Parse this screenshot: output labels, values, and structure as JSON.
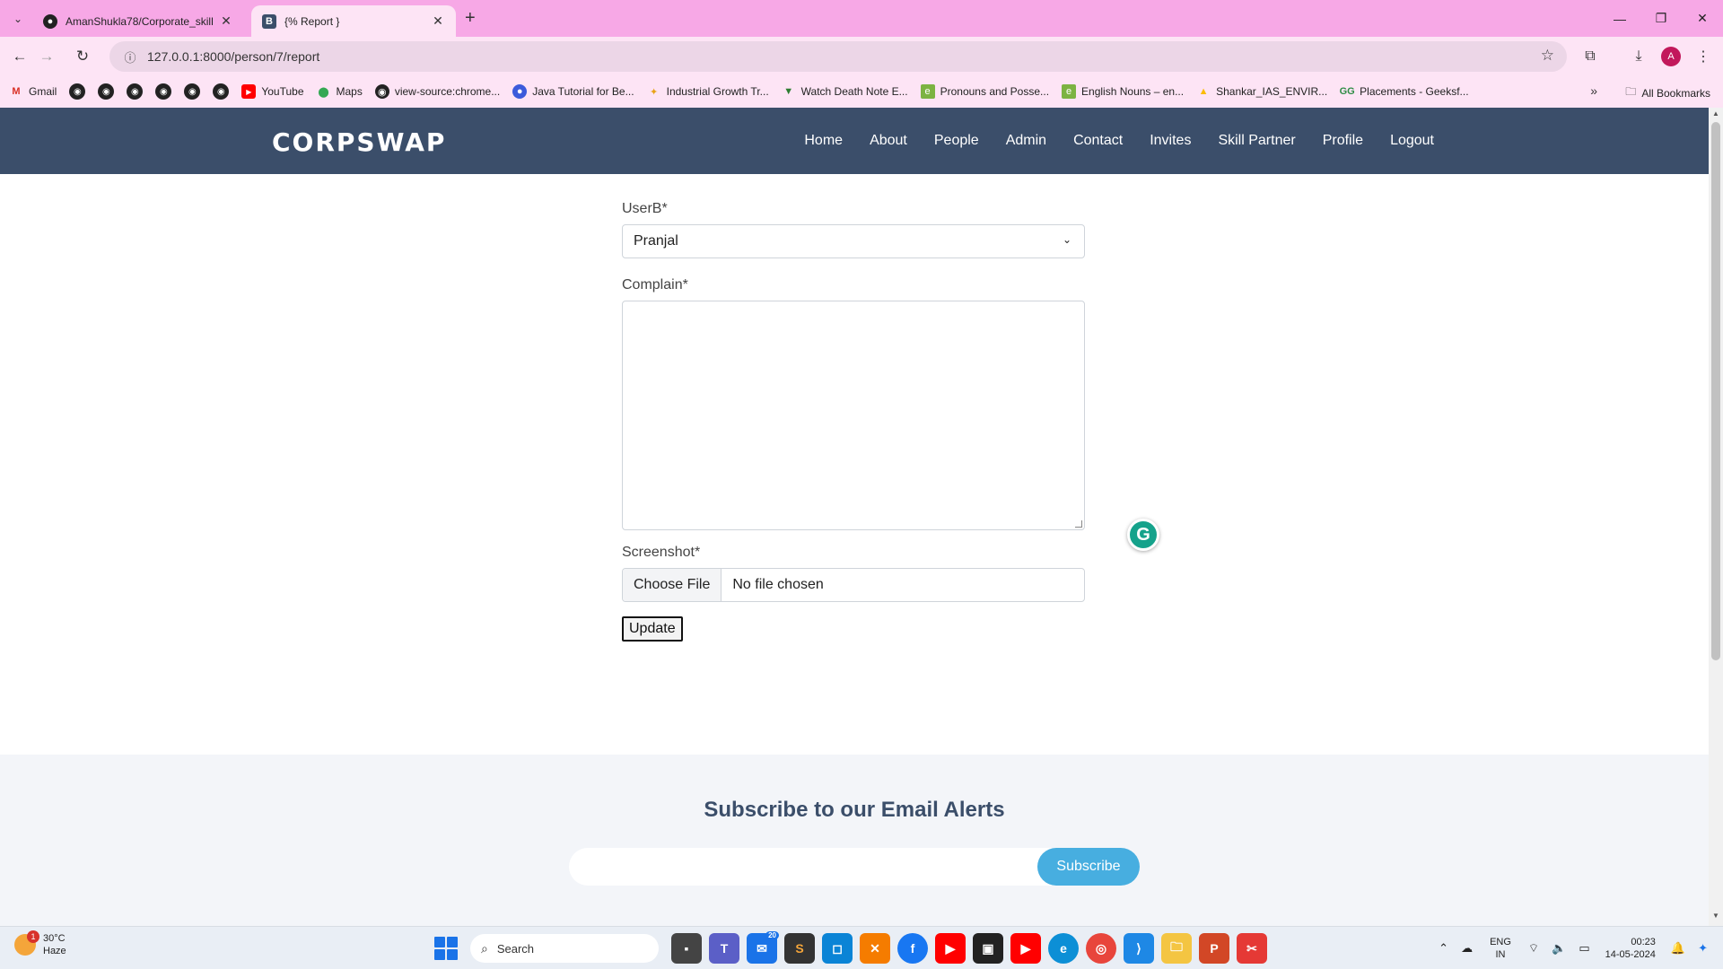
{
  "browser": {
    "tabs": [
      {
        "title": "AmanShukla78/Corporate_skill",
        "favicon": "github-icon"
      },
      {
        "title": "{% Report }",
        "favicon": "B",
        "active": true
      }
    ],
    "url": "127.0.0.1:8000/person/7/report",
    "bookmarks": [
      {
        "label": "Gmail"
      },
      {
        "label": "YouTube"
      },
      {
        "label": "Maps"
      },
      {
        "label": "view-source:chrome..."
      },
      {
        "label": "Java Tutorial for Be..."
      },
      {
        "label": "Industrial Growth Tr..."
      },
      {
        "label": "Watch Death Note E..."
      },
      {
        "label": "Pronouns and Posse..."
      },
      {
        "label": "English Nouns – en..."
      },
      {
        "label": "Shankar_IAS_ENVIR..."
      },
      {
        "label": "Placements - Geeksf..."
      }
    ],
    "all_bookmarks": "All Bookmarks",
    "profile_initial": "A"
  },
  "site": {
    "logo": "CORPSWAP",
    "nav": [
      "Home",
      "About",
      "People",
      "Admin",
      "Contact",
      "Invites",
      "Skill Partner",
      "Profile",
      "Logout"
    ]
  },
  "form": {
    "userb_label": "UserB*",
    "userb_value": "Pranjal",
    "complain_label": "Complain*",
    "screenshot_label": "Screenshot*",
    "choose_file": "Choose File",
    "no_file": "No file chosen",
    "submit": "Update"
  },
  "subscribe": {
    "title": "Subscribe to our Email Alerts",
    "button": "Subscribe"
  },
  "taskbar": {
    "weather_temp": "30°C",
    "weather_desc": "Haze",
    "weather_badge": "1",
    "search": "Search",
    "mail_count": "20",
    "lang_line1": "ENG",
    "lang_line2": "IN",
    "time": "00:23",
    "date": "14-05-2024"
  },
  "colors": {
    "tabstrip": "#f7a8e6",
    "site_header": "#3b4e6a",
    "subscribe_button": "#47aee0"
  }
}
